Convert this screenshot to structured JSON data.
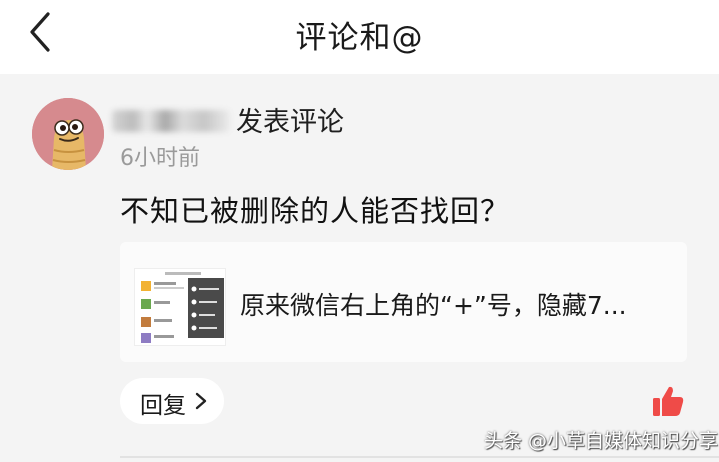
{
  "header": {
    "title": "评论和@",
    "back_icon": "chevron-left-icon"
  },
  "comment": {
    "action": "发表评论",
    "time": "6小时前",
    "text": "不知已被删除的人能否找回？",
    "avatar_icon": "cartoon-character-avatar"
  },
  "article": {
    "title": "原来微信右上角的“+”号，隐藏7..."
  },
  "actions": {
    "reply_label": "回复",
    "reply_icon": "chevron-right-icon",
    "like_icon": "thumbs-up-icon"
  },
  "colors": {
    "like": "#ef4b48",
    "background": "#f4f4f4",
    "avatar_bg": "#d68a8e"
  },
  "watermark": {
    "text": "头条 @小草自媒体知识分享"
  }
}
